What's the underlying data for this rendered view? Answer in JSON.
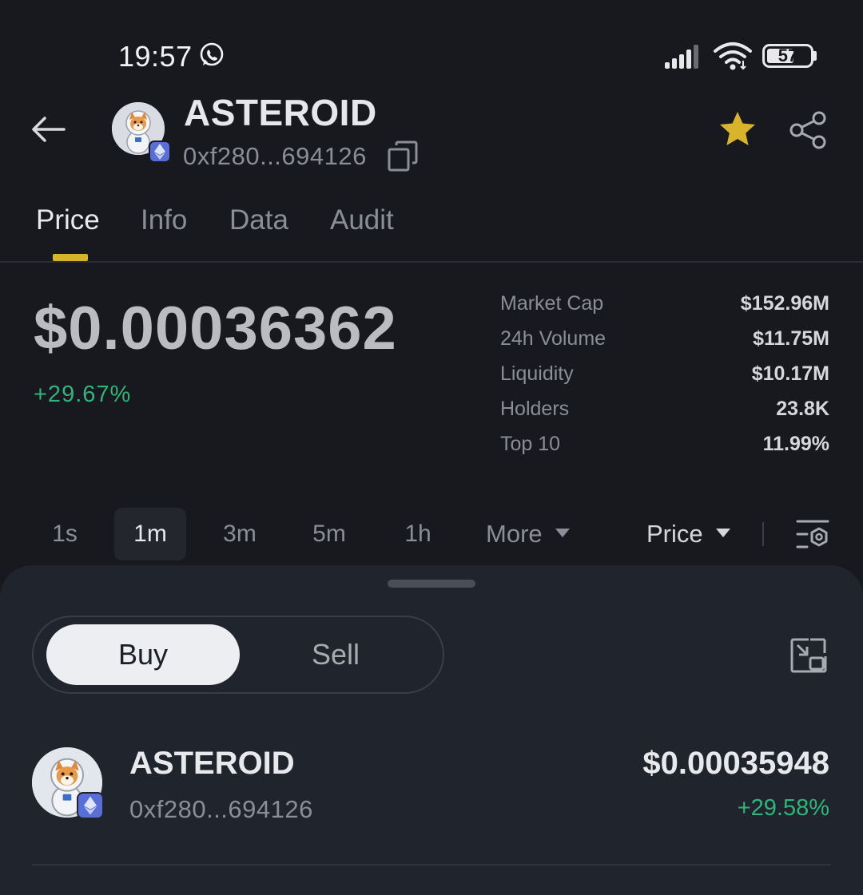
{
  "status_bar": {
    "time": "19:57",
    "battery": "57"
  },
  "header": {
    "token_name": "ASTEROID",
    "token_address": "0xf280...694126",
    "favorite_color": "#d8b42b"
  },
  "tabs": [
    {
      "label": "Price",
      "active": true
    },
    {
      "label": "Info",
      "active": false
    },
    {
      "label": "Data",
      "active": false
    },
    {
      "label": "Audit",
      "active": false
    }
  ],
  "price": {
    "value": "$0.00036362",
    "change": "+29.67%"
  },
  "stats": [
    {
      "label": "Market Cap",
      "value": "$152.96M"
    },
    {
      "label": "24h Volume",
      "value": "$11.75M"
    },
    {
      "label": "Liquidity",
      "value": "$10.17M"
    },
    {
      "label": "Holders",
      "value": "23.8K"
    },
    {
      "label": "Top 10",
      "value": "11.99%"
    }
  ],
  "intervals": {
    "options": [
      "1s",
      "1m",
      "3m",
      "5m",
      "1h"
    ],
    "selected": "1m",
    "more_label": "More",
    "chart_type_label": "Price"
  },
  "trade_sheet": {
    "buy_label": "Buy",
    "sell_label": "Sell",
    "selected_side": "Buy",
    "asset": {
      "name": "ASTEROID",
      "address": "0xf280...694126",
      "price": "$0.00035948",
      "change": "+29.58%"
    }
  },
  "colors": {
    "positive": "#2fb57a",
    "accent": "#d8b42b",
    "eth_badge": "#5a6fd6"
  }
}
